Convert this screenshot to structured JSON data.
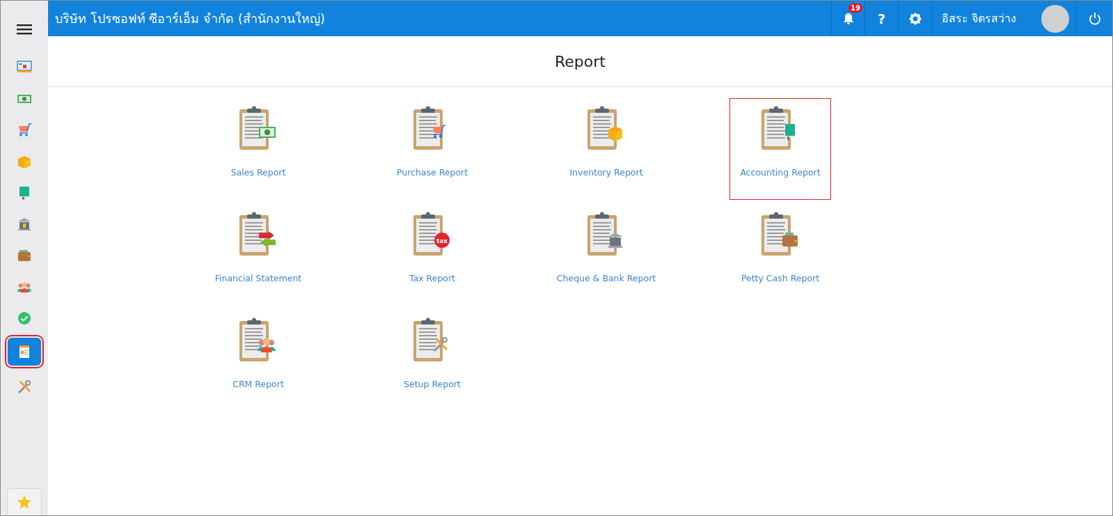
{
  "header": {
    "company": "บริษัท โปรซอฟท์ ซีอาร์เอ็ม จำกัด (สำนักงานใหญ่)",
    "notification_count": "19",
    "help": "?",
    "user_name": "อิสระ จิตรสว่าง"
  },
  "sidebar": {
    "items": [
      {
        "selected": false
      },
      {
        "selected": false
      },
      {
        "selected": false
      },
      {
        "selected": false
      },
      {
        "selected": false
      },
      {
        "selected": false
      },
      {
        "selected": false
      },
      {
        "selected": false
      },
      {
        "selected": false
      },
      {
        "selected": true
      },
      {
        "selected": false
      }
    ]
  },
  "page_title": "Report",
  "reports": [
    {
      "label": "Sales Report",
      "selected": false
    },
    {
      "label": "Purchase Report",
      "selected": false
    },
    {
      "label": "Inventory Report",
      "selected": false
    },
    {
      "label": "Accounting Report",
      "selected": true
    },
    {
      "label": "Financial Statement",
      "selected": false
    },
    {
      "label": "Tax Report",
      "selected": false,
      "icon_label": "tax"
    },
    {
      "label": "Cheque & Bank Report",
      "selected": false
    },
    {
      "label": "Petty Cash Report",
      "selected": false
    },
    {
      "label": "CRM Report",
      "selected": false
    },
    {
      "label": "Setup Report",
      "selected": false
    }
  ]
}
